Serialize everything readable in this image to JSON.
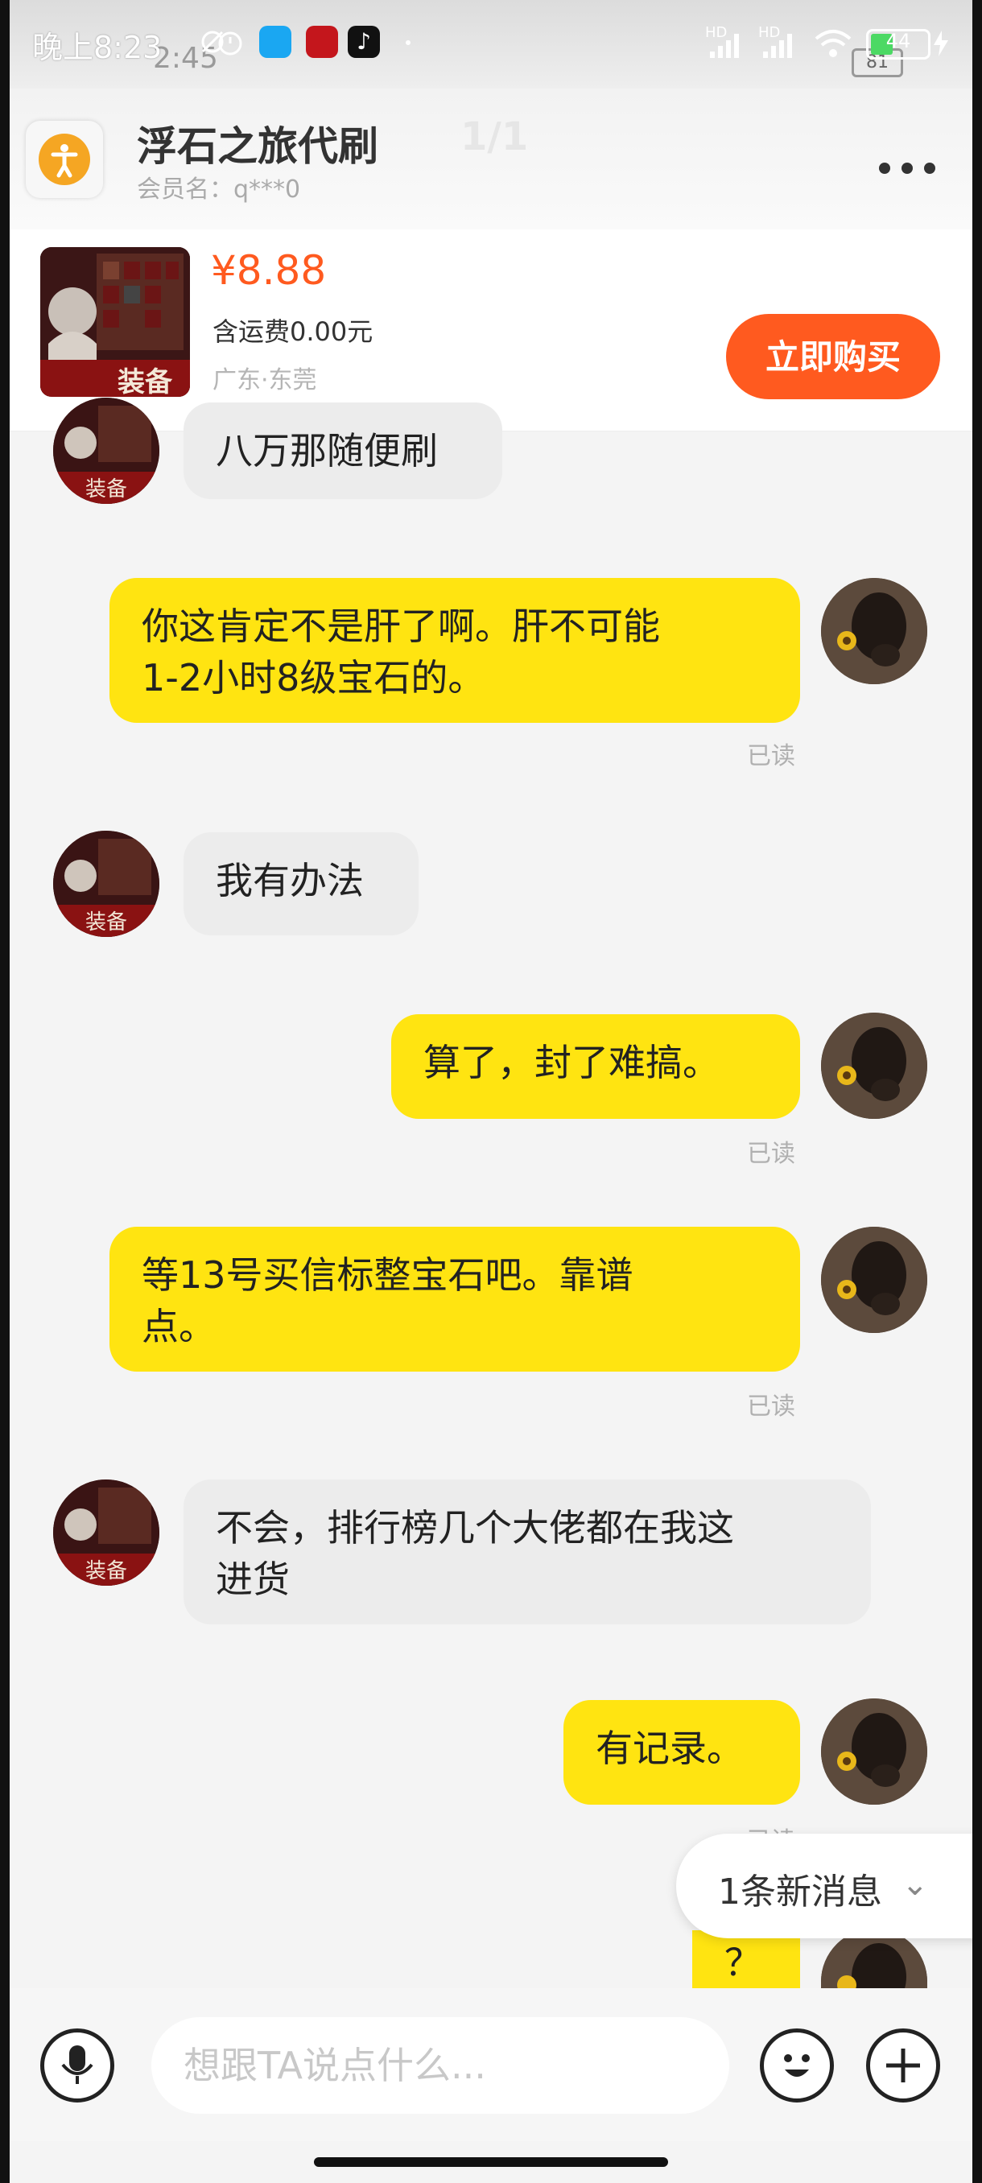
{
  "status_bar": {
    "time": "晚上8:23",
    "ghost_time": "2:45",
    "hd1": "HD",
    "hd2": "HD",
    "battery": "44",
    "ghost_battery": "81",
    "battery_level": 0.44,
    "icons": [
      "no-alarm-icon",
      "alarm-clock-icon",
      "app-blue-icon",
      "app-red-icon",
      "tiktok-icon",
      "dot-icon",
      "signal-icon",
      "wifi-icon",
      "battery-icon",
      "charging-icon"
    ]
  },
  "header": {
    "title": "浮石之旅代刷",
    "page_indicator": "1/1",
    "member_label": "会员名：q***0"
  },
  "product": {
    "price": "¥8.88",
    "shipping": "含运费0.00元",
    "location": "广东·东莞",
    "buy_label": "立即购买",
    "thumb_text": "装备"
  },
  "messages": [
    {
      "side": "in",
      "text": "八万那随便刷"
    },
    {
      "side": "out",
      "lines": [
        "你这肯定不是肝了啊。肝不可能",
        "1-2小时8级宝石的。"
      ],
      "status": "已读"
    },
    {
      "side": "in",
      "text": "我有办法"
    },
    {
      "side": "out",
      "text": "算了，封了难搞。",
      "status": "已读"
    },
    {
      "side": "out",
      "lines": [
        "等13号买信标整宝石吧。靠谱",
        "点。"
      ],
      "status": "已读"
    },
    {
      "side": "in",
      "lines": [
        "不会，排行榜几个大佬都在我这",
        "进货"
      ]
    },
    {
      "side": "out",
      "text": "有记录。",
      "status": "已读"
    },
    {
      "side": "out",
      "text": "？"
    }
  ],
  "new_message": {
    "label": "1条新消息",
    "chevron": "⌄"
  },
  "input": {
    "placeholder": "想跟TA说点什么..."
  },
  "colors": {
    "outgoing_bubble": "#ffe411",
    "incoming_bubble": "#ececec",
    "accent": "#ff5a1f"
  }
}
